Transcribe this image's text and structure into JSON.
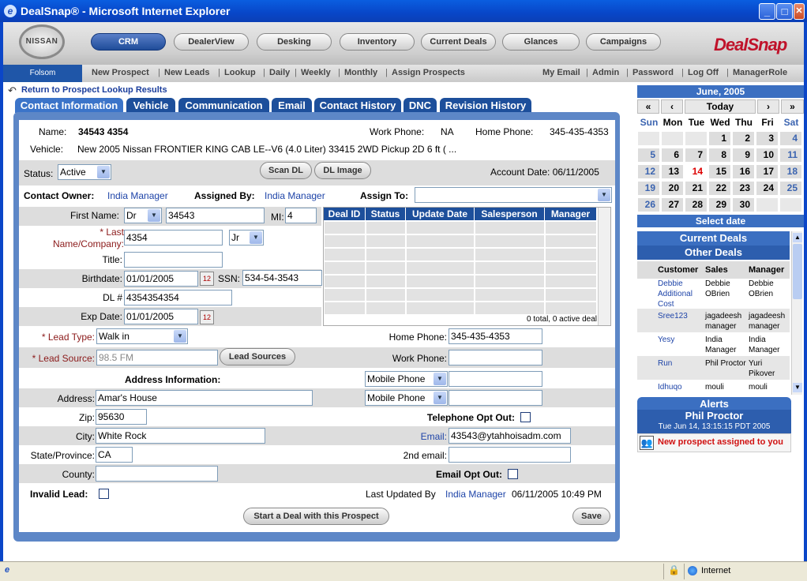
{
  "window": {
    "title": "DealSnap® - Microsoft Internet Explorer"
  },
  "header": {
    "logo_text": "NISSAN",
    "brand": "DealSnap",
    "nav": [
      "CRM",
      "DealerView",
      "Desking",
      "Inventory",
      "Current Deals",
      "Glances",
      "Campaigns"
    ]
  },
  "subnav": {
    "location": "Folsom",
    "left": [
      "New Prospect",
      "New Leads",
      "Lookup",
      "Daily",
      "Weekly",
      "Monthly",
      "Assign Prospects"
    ],
    "right": [
      "My Email",
      "Admin",
      "Password",
      "Log Off",
      "ManagerRole"
    ]
  },
  "return_link": "Return to Prospect Lookup Results",
  "tabs": [
    "Contact Information",
    "Vehicle",
    "Communication",
    "Email",
    "Contact History",
    "DNC",
    "Revision History"
  ],
  "summary": {
    "name_label": "Name:",
    "name": "34543 4354",
    "work_label": "Work Phone:",
    "work": "NA",
    "home_label": "Home Phone:",
    "home": "345-435-4353",
    "vehicle_label": "Vehicle:",
    "vehicle": "New 2005 Nissan FRONTIER KING CAB LE--V6 (4.0 Liter) 33415 2WD Pickup 2D 6 ft ( ..."
  },
  "status": {
    "label": "Status:",
    "value": "Active",
    "scan_dl": "Scan DL",
    "dl_image": "DL Image",
    "account_date": "Account Date: 06/11/2005"
  },
  "owner": {
    "owner_label": "Contact Owner:",
    "owner": "India Manager",
    "assigned_label": "Assigned By:",
    "assigned": "India Manager",
    "assign_to_label": "Assign To:"
  },
  "form": {
    "first_name_label": "First Name:",
    "prefix": "Dr",
    "first_name": "34543",
    "mi_label": "MI:",
    "mi": "4",
    "last_name_label_1": "* Last",
    "last_name_label_2": "Name/Company:",
    "last_name": "4354",
    "suffix": "Jr",
    "title_label": "Title:",
    "title": "",
    "birthdate_label": "Birthdate:",
    "birthdate": "01/01/2005",
    "ssn_label": "SSN:",
    "ssn": "534-54-3543",
    "dl_label": "DL #",
    "dl": "4354354354",
    "exp_label": "Exp Date:",
    "exp": "01/01/2005",
    "lead_type_label": "* Lead Type:",
    "lead_type": "Walk in",
    "lead_source_label": "* Lead Source:",
    "lead_source": "98.5 FM",
    "lead_sources_btn": "Lead Sources",
    "home_phone_label": "Home Phone:",
    "home_phone": "345-435-4353",
    "work_phone_label": "Work Phone:",
    "work_phone": "",
    "address_info_label": "Address Information:",
    "phone_type_1": "Mobile Phone",
    "phone_type_2": "Mobile Phone",
    "address_label": "Address:",
    "address": "Amar's House",
    "zip_label": "Zip:",
    "zip": "95630",
    "tel_opt_out_label": "Telephone Opt Out:",
    "city_label": "City:",
    "city": "White Rock",
    "email_label": "Email:",
    "email": "43543@ytahhoisadm.com",
    "state_label": "State/Province:",
    "state": "CA",
    "email2_label": "2nd email:",
    "county_label": "County:",
    "email_opt_out_label": "Email Opt Out:",
    "invalid_lead_label": "Invalid Lead:",
    "last_updated_prefix": "Last Updated By",
    "last_updated_by": "India Manager",
    "last_updated_time": "06/11/2005 10:49 PM",
    "start_deal_btn": "Start a Deal with this Prospect",
    "save_btn": "Save"
  },
  "deal_grid": {
    "headers": [
      "Deal ID",
      "Status",
      "Update Date",
      "Salesperson",
      "Manager"
    ],
    "footer": "0 total, 0 active deal"
  },
  "calendar": {
    "month": "June, 2005",
    "nav": [
      "«",
      "‹",
      "Today",
      "›",
      "»"
    ],
    "dow": [
      "Sun",
      "Mon",
      "Tue",
      "Wed",
      "Thu",
      "Fri",
      "Sat"
    ],
    "weeks": [
      [
        "",
        "",
        "",
        "1",
        "2",
        "3",
        "4"
      ],
      [
        "5",
        "6",
        "7",
        "8",
        "9",
        "10",
        "11"
      ],
      [
        "12",
        "13",
        "14",
        "15",
        "16",
        "17",
        "18"
      ],
      [
        "19",
        "20",
        "21",
        "22",
        "23",
        "24",
        "25"
      ],
      [
        "26",
        "27",
        "28",
        "29",
        "30",
        "",
        ""
      ]
    ],
    "today": "14",
    "footer": "Select date"
  },
  "deals": {
    "title": "Current Deals",
    "subtitle": "Other Deals",
    "headers": [
      "Customer",
      "Sales",
      "Manager"
    ],
    "rows": [
      [
        "Debbie Additional Cost",
        "Debbie OBrien",
        "Debbie OBrien"
      ],
      [
        "Sree123",
        "jagadeesh manager",
        "jagadeesh manager"
      ],
      [
        "Yesy",
        "India Manager",
        "India Manager"
      ],
      [
        "Run",
        "Phil Proctor",
        "Yuri Pikover"
      ],
      [
        "Idhuqo",
        "mouli",
        "mouli"
      ]
    ]
  },
  "alerts": {
    "title": "Alerts",
    "name": "Phil Proctor",
    "time": "Tue Jun 14, 13:15:15 PDT 2005",
    "message": "New prospect assigned to you"
  },
  "statusbar": {
    "zone": "Internet"
  }
}
